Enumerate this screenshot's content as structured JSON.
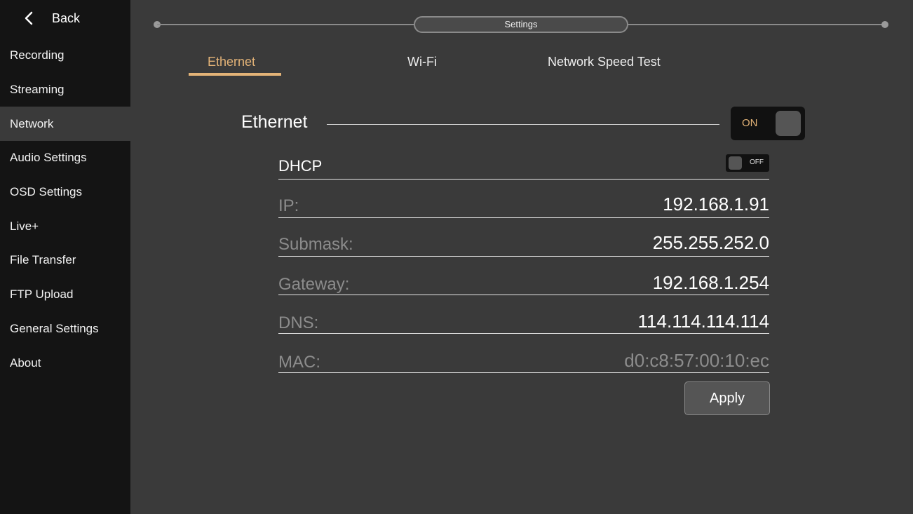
{
  "sidebar": {
    "back_label": "Back",
    "items": [
      {
        "label": "Recording"
      },
      {
        "label": "Streaming"
      },
      {
        "label": "Network"
      },
      {
        "label": "Audio Settings"
      },
      {
        "label": "OSD Settings"
      },
      {
        "label": "Live+"
      },
      {
        "label": "File Transfer"
      },
      {
        "label": "FTP Upload"
      },
      {
        "label": "General Settings"
      },
      {
        "label": "About"
      }
    ],
    "active_item": "Network"
  },
  "header": {
    "title": "Settings"
  },
  "tabs": [
    {
      "label": "Ethernet"
    },
    {
      "label": "Wi-Fi"
    },
    {
      "label": "Network Speed Test"
    }
  ],
  "active_tab": "Ethernet",
  "ethernet": {
    "section_title": "Ethernet",
    "toggle_label": "ON",
    "enabled": true,
    "dhcp": {
      "label": "DHCP",
      "toggle_label": "OFF",
      "enabled": false
    },
    "fields": [
      {
        "label": "IP:",
        "value": "192.168.1.91"
      },
      {
        "label": "Submask:",
        "value": "255.255.252.0"
      },
      {
        "label": "Gateway:",
        "value": "192.168.1.254"
      },
      {
        "label": "DNS:",
        "value": "114.114.114.114"
      },
      {
        "label": "MAC:",
        "value": "d0:c8:57:00:10:ec"
      }
    ],
    "apply_label": "Apply"
  },
  "colors": {
    "accent": "#e3b377",
    "background": "#3a3a3a",
    "sidebar": "#141414"
  }
}
